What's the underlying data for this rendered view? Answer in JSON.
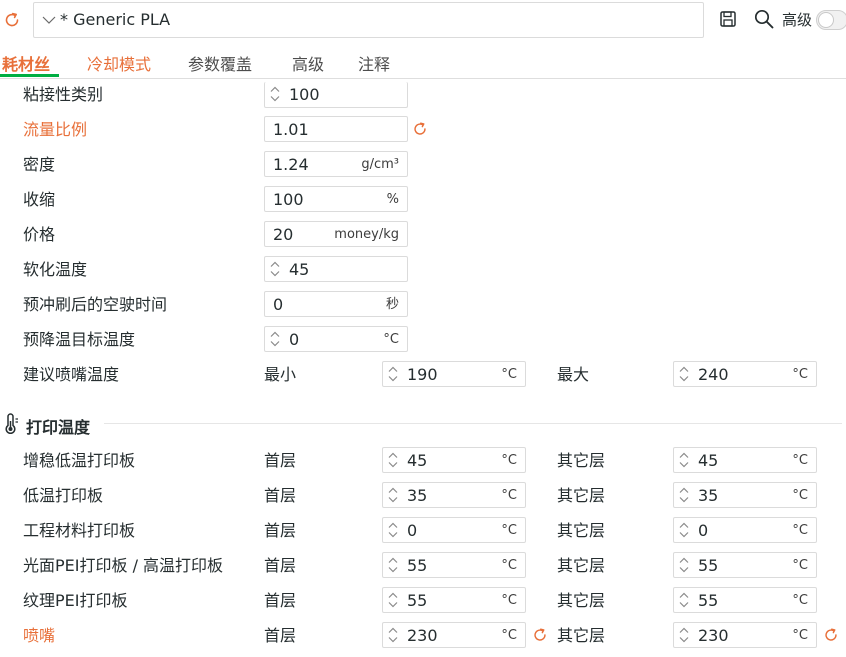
{
  "header": {
    "preset_name": "* Generic PLA",
    "advanced_label": "高级",
    "advanced_enabled": false,
    "icons": [
      "reset-icon",
      "chevron-down-icon",
      "save-icon",
      "search-icon"
    ]
  },
  "colors": {
    "accent": "#e8703a",
    "brand": "#00ae42",
    "text": "#262e30",
    "border": "#dbdbdb"
  },
  "tabs": [
    {
      "label": "耗材丝",
      "state": "active"
    },
    {
      "label": "冷却模式",
      "state": "modified"
    },
    {
      "label": "参数覆盖",
      "state": "normal"
    },
    {
      "label": "高级",
      "state": "normal"
    },
    {
      "label": "注释",
      "state": "normal"
    }
  ],
  "rows": {
    "adhesion": {
      "label": "粘接性类别",
      "value": "100"
    },
    "flow": {
      "label": "流量比例",
      "value": "1.01"
    },
    "density": {
      "label": "密度",
      "value": "1.24",
      "unit": "g/cm³"
    },
    "shrink": {
      "label": "收缩",
      "value": "100",
      "unit": "%"
    },
    "price": {
      "label": "价格",
      "value": "20",
      "unit": "money/kg"
    },
    "soften": {
      "label": "软化温度",
      "value": "45"
    },
    "purge": {
      "label": "预冲刷后的空驶时间",
      "value": "0",
      "unit": "秒"
    },
    "precool": {
      "label": "预降温目标温度",
      "value": "0",
      "unit": "°C"
    },
    "nozzle_range": {
      "label": "建议喷嘴温度",
      "min_label": "最小",
      "min_value": "190",
      "max_label": "最大",
      "max_value": "240",
      "unit": "°C"
    }
  },
  "print_temp": {
    "title": "打印温度",
    "first_label": "首层",
    "other_label": "其它层",
    "unit": "°C",
    "plates": [
      {
        "label": "增稳低温打印板",
        "first": "45",
        "other": "45"
      },
      {
        "label": "低温打印板",
        "first": "35",
        "other": "35"
      },
      {
        "label": "工程材料打印板",
        "first": "0",
        "other": "0"
      },
      {
        "label": "光面PEI打印板 / 高温打印板",
        "first": "55",
        "other": "55"
      },
      {
        "label": "纹理PEI打印板",
        "first": "55",
        "other": "55"
      },
      {
        "label": "喷嘴",
        "first": "230",
        "other": "230"
      }
    ]
  }
}
